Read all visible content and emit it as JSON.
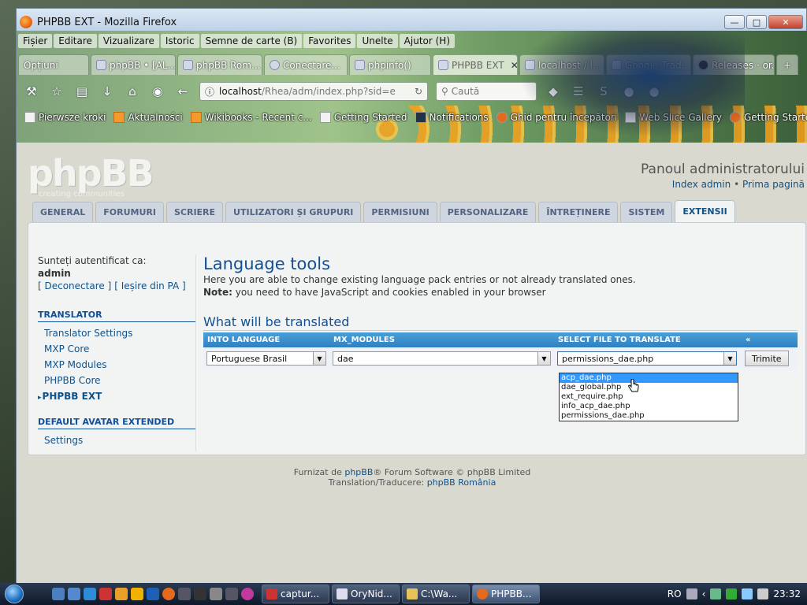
{
  "window": {
    "title": "PHPBB EXT - Mozilla Firefox"
  },
  "menu": [
    "Fișier",
    "Editare",
    "Vizualizare",
    "Istoric",
    "Semne de carte (B)",
    "Favorites",
    "Unelte",
    "Ajutor (H)"
  ],
  "tabs": [
    {
      "label": "Opțiuni"
    },
    {
      "label": "phpBB • [AL..."
    },
    {
      "label": "phpBB Rom..."
    },
    {
      "label": "Conectare..."
    },
    {
      "label": "phpinfo()"
    },
    {
      "label": "PHPBB EXT"
    },
    {
      "label": "localhost / l..."
    },
    {
      "label": "Google Trad..."
    },
    {
      "label": "Releases · or..."
    }
  ],
  "url": {
    "host": "localhost",
    "path": "/Rhea/adm/index.php?sid=e"
  },
  "search": {
    "placeholder": "Caută"
  },
  "bookmarks": [
    "Pierwsze kroki",
    "Aktualności",
    "Wikibooks - Recent c...",
    "Getting Started",
    "Notifications",
    "Ghid pentru începători",
    "Web Slice Gallery",
    "Getting Started"
  ],
  "phpbb": {
    "logo": "phpBB",
    "tagline": "creating communities",
    "acp_title": "Panoul administratorului",
    "link_index": "Index admin",
    "link_home": "Prima pagină"
  },
  "acp_tabs": [
    "GENERAL",
    "FORUMURI",
    "SCRIERE",
    "UTILIZATORI ȘI GRUPURI",
    "PERMISIUNI",
    "PERSONALIZARE",
    "ÎNTREȚINERE",
    "SISTEM",
    "EXTENSII"
  ],
  "sidebar": {
    "logged_as": "Sunteți autentificat ca:",
    "user": "admin",
    "logout": "[ Deconectare ]",
    "exit": "[ Ieșire din PA ]",
    "section1": "TRANSLATOR",
    "items1": [
      "Translator Settings",
      "MXP Core",
      "MXP Modules",
      "PHPBB Core",
      "PHPBB EXT"
    ],
    "section2": "DEFAULT AVATAR EXTENDED",
    "items2": [
      "Settings"
    ]
  },
  "main": {
    "title": "Language tools",
    "desc": "Here you are able to change existing language pack entries or not already translated ones.",
    "note_label": "Note:",
    "note_text": " you need to have JavaScript and cookies enabled in your browser",
    "subtitle": "What will be translated",
    "col_lang": "INTO LANGUAGE",
    "col_mod": "MX_MODULES",
    "col_file": "SELECT FILE TO TRANSLATE",
    "col_collapse": "«",
    "lang_value": "Portuguese Brasil",
    "mod_value": "dae",
    "file_value": "permissions_dae.php",
    "submit": "Trimite",
    "file_options": [
      "acp_dae.php",
      "dae_global.php",
      "ext_require.php",
      "info_acp_dae.php",
      "permissions_dae.php"
    ]
  },
  "footer": {
    "line1_a": "Furnizat de ",
    "line1_link": "phpBB",
    "line1_b": "® Forum Software © phpBB Limited",
    "line2_a": "Translation/Traducere: ",
    "line2_link": "phpBB România"
  },
  "taskbar": {
    "tasks": [
      "captur...",
      "OryNid...",
      "C:\\Wa...",
      "PHPBB..."
    ],
    "lang": "RO",
    "clock": "23:32"
  }
}
